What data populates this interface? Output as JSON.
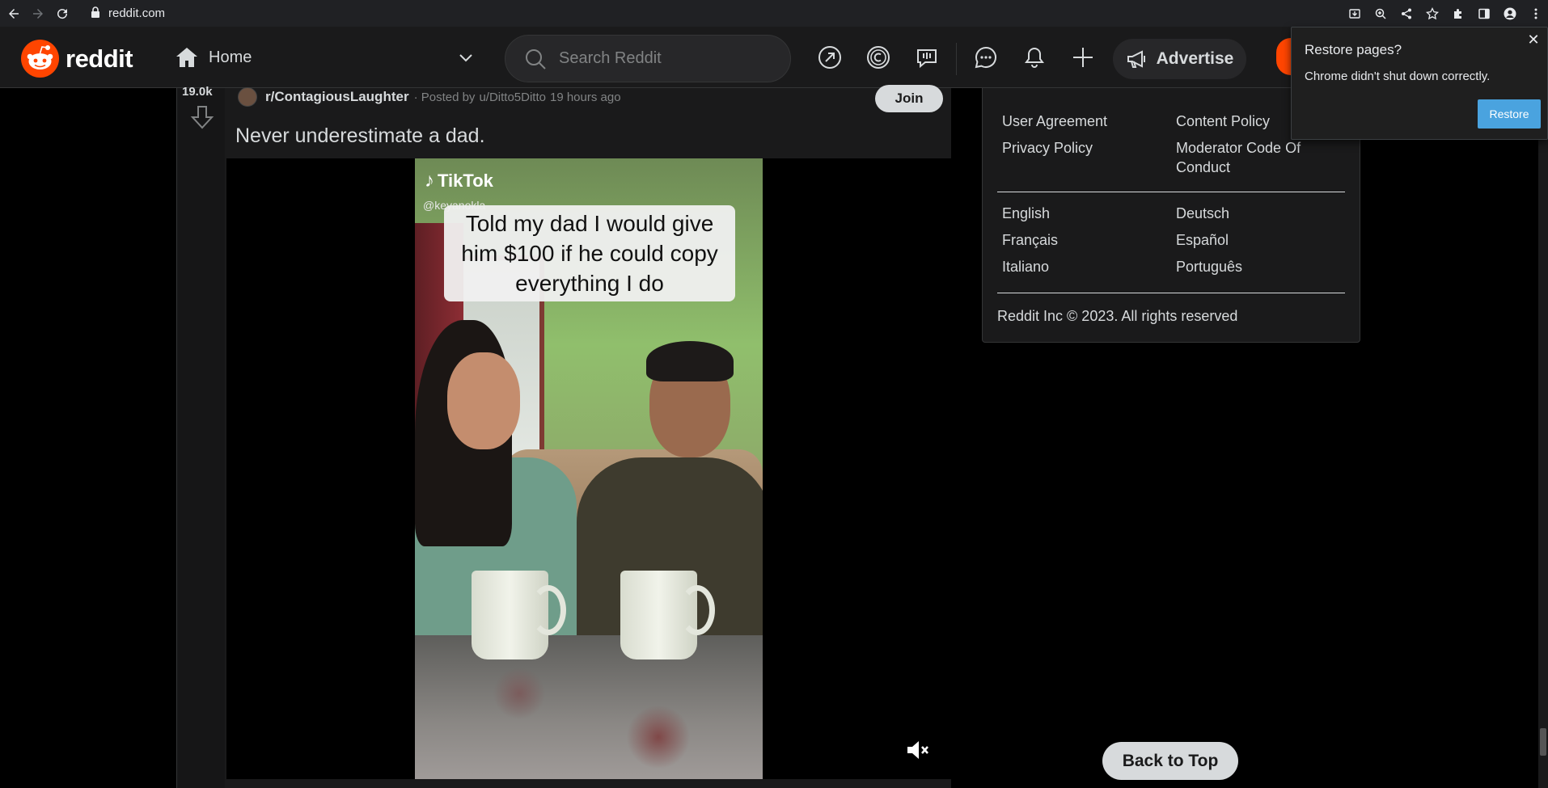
{
  "browser": {
    "url": "reddit.com"
  },
  "header": {
    "logo_text": "reddit",
    "home_label": "Home",
    "search_placeholder": "Search Reddit",
    "advertise_label": "Advertise"
  },
  "post": {
    "score": "19.0k",
    "subreddit": "r/ContagiousLaughter",
    "posted_by_prefix": "· Posted by",
    "author": "u/Ditto5Ditto",
    "time_ago": "19 hours ago",
    "join_label": "Join",
    "title": "Never underestimate a dad.",
    "video": {
      "watermark": "TikTok",
      "handle": "@keyanokla",
      "caption": "Told my dad I would give him $100 if he could copy everything I do"
    }
  },
  "sidebar": {
    "policy_links": [
      "User Agreement",
      "Content Policy",
      "Privacy Policy",
      "Moderator Code Of Conduct"
    ],
    "languages": [
      "English",
      "Deutsch",
      "Français",
      "Español",
      "Italiano",
      "Português"
    ],
    "copyright": "Reddit Inc © 2023. All rights reserved"
  },
  "back_to_top_label": "Back to Top",
  "restore_popup": {
    "title": "Restore pages?",
    "body": "Chrome didn't shut down correctly.",
    "button": "Restore"
  },
  "colors": {
    "brand": "#ff4500",
    "restore_button": "#4aa3df",
    "page_bg": "#000000",
    "card_bg": "#1a1a1b"
  }
}
